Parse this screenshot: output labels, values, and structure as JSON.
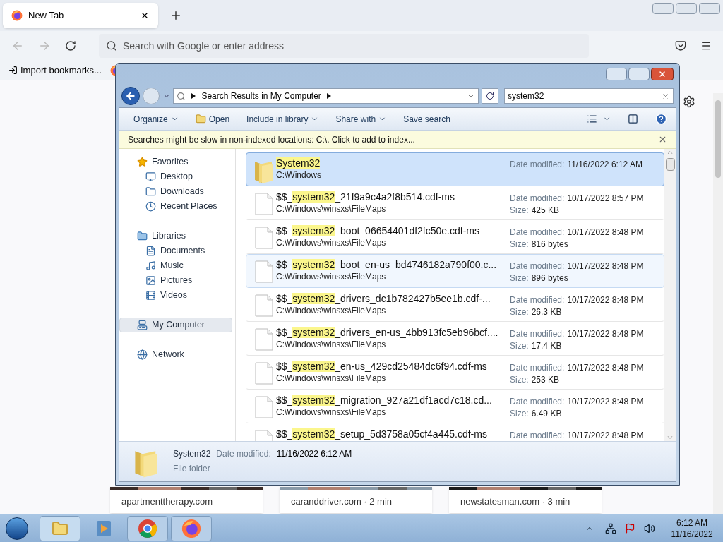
{
  "browser": {
    "tabs": [
      {
        "label": "New Tab",
        "selected": true
      }
    ],
    "address_placeholder": "Search with Google or enter address",
    "bookmarks": [
      "Import bookmarks..."
    ],
    "page": {
      "cards": [
        {
          "source": "apartmenttherapy.com"
        },
        {
          "source": "caranddriver.com · 2 min"
        },
        {
          "source": "newstatesman.com · 3 min"
        }
      ]
    }
  },
  "explorer": {
    "breadcrumb": "Search Results in My Computer",
    "search_value": "system32",
    "toolbar": [
      "Organize",
      "Open",
      "Include in library",
      "Share with",
      "Save search"
    ],
    "info_bar": "Searches might be slow in non-indexed locations: C:\\. Click to add to index...",
    "nav": [
      {
        "label": "Favorites",
        "kind": "group",
        "selected": false,
        "children": [
          {
            "label": "Desktop",
            "kind": "desktop",
            "selected": false
          },
          {
            "label": "Downloads",
            "kind": "folder",
            "selected": false
          },
          {
            "label": "Recent Places",
            "kind": "recent",
            "selected": false
          }
        ]
      },
      {
        "label": "Libraries",
        "kind": "group",
        "selected": false,
        "children": [
          {
            "label": "Documents",
            "kind": "doc",
            "selected": false
          },
          {
            "label": "Music",
            "kind": "music",
            "selected": false
          },
          {
            "label": "Pictures",
            "kind": "pic",
            "selected": false
          },
          {
            "label": "Videos",
            "kind": "video",
            "selected": false
          }
        ]
      },
      {
        "label": "My Computer",
        "kind": "computer",
        "selected": true
      },
      {
        "label": "Network",
        "kind": "network",
        "selected": false
      }
    ],
    "results": [
      {
        "kind": "folder",
        "match": "System32",
        "path": "C:\\Windows",
        "date_label": "Date modified:",
        "date": "11/16/2022 6:12 AM",
        "selected": true,
        "hovered": false
      },
      {
        "kind": "file",
        "prefix": "$$_",
        "match": "system32",
        "suffix": "_21f9a9c4a2f8b514.cdf-ms",
        "path": "C:\\Windows\\winsxs\\FileMaps",
        "date_label": "Date modified:",
        "date": "10/17/2022 8:57 PM",
        "size_label": "Size:",
        "size": "425 KB",
        "selected": false,
        "hovered": false
      },
      {
        "kind": "file",
        "prefix": "$$_",
        "match": "system32",
        "suffix": "_boot_06654401df2fc50e.cdf-ms",
        "path": "C:\\Windows\\winsxs\\FileMaps",
        "date_label": "Date modified:",
        "date": "10/17/2022 8:48 PM",
        "size_label": "Size:",
        "size": "816 bytes",
        "selected": false,
        "hovered": false
      },
      {
        "kind": "file",
        "prefix": "$$_",
        "match": "system32",
        "suffix": "_boot_en-us_bd4746182a790f00.c...",
        "path": "C:\\Windows\\winsxs\\FileMaps",
        "date_label": "Date modified:",
        "date": "10/17/2022 8:48 PM",
        "size_label": "Size:",
        "size": "896 bytes",
        "selected": false,
        "hovered": true
      },
      {
        "kind": "file",
        "prefix": "$$_",
        "match": "system32",
        "suffix": "_drivers_dc1b782427b5ee1b.cdf-...",
        "path": "C:\\Windows\\winsxs\\FileMaps",
        "date_label": "Date modified:",
        "date": "10/17/2022 8:48 PM",
        "size_label": "Size:",
        "size": "26.3 KB",
        "selected": false,
        "hovered": false
      },
      {
        "kind": "file",
        "prefix": "$$_",
        "match": "system32",
        "suffix": "_drivers_en-us_4bb913fc5eb96bcf....",
        "path": "C:\\Windows\\winsxs\\FileMaps",
        "date_label": "Date modified:",
        "date": "10/17/2022 8:48 PM",
        "size_label": "Size:",
        "size": "17.4 KB",
        "selected": false,
        "hovered": false
      },
      {
        "kind": "file",
        "prefix": "$$_",
        "match": "system32",
        "suffix": "_en-us_429cd25484dc6f94.cdf-ms",
        "path": "C:\\Windows\\winsxs\\FileMaps",
        "date_label": "Date modified:",
        "date": "10/17/2022 8:48 PM",
        "size_label": "Size:",
        "size": "253 KB",
        "selected": false,
        "hovered": false
      },
      {
        "kind": "file",
        "prefix": "$$_",
        "match": "system32",
        "suffix": "_migration_927a21df1acd7c18.cd...",
        "path": "C:\\Windows\\winsxs\\FileMaps",
        "date_label": "Date modified:",
        "date": "10/17/2022 8:48 PM",
        "size_label": "Size:",
        "size": "6.49 KB",
        "selected": false,
        "hovered": false
      },
      {
        "kind": "file",
        "prefix": "$$_",
        "match": "system32",
        "suffix": "_setup_5d3758a05cf4a445.cdf-ms",
        "date_label": "Date modified:",
        "date": "10/17/2022 8:48 PM",
        "selected": false,
        "hovered": false
      }
    ],
    "details": {
      "name": "System32",
      "date_label": "Date modified:",
      "date": "11/16/2022 6:12 AM",
      "type": "File folder"
    }
  },
  "taskbar": {
    "clock_time": "6:12 AM",
    "clock_date": "11/16/2022"
  }
}
